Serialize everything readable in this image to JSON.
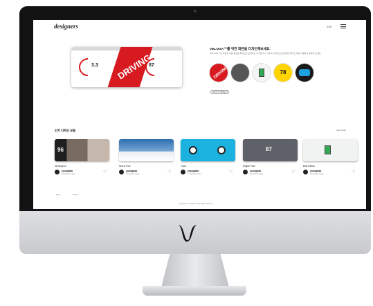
{
  "site": {
    "brand": "designers",
    "lang": "KOR",
    "title": "VELOGA™를 위한 화면을 디자인해보세요.",
    "description": "VELOGA™는 다양한 차량 정보를 화면으로 보여주는 기기입니다. 나만의 디자인으로 화면을 꾸미고 다른 사람들과 공유해 보세요.",
    "button_label": "디자인 더 알아보기"
  },
  "hero": {
    "word": "DRIVING",
    "left_value": "3.3",
    "right_value": "87"
  },
  "circles": [
    {
      "label": "DRIVING"
    },
    {
      "label": ""
    },
    {
      "label": ""
    },
    {
      "label": "78"
    },
    {
      "label": ""
    }
  ],
  "section": {
    "title": "인기 디자인 모음",
    "more": "View More"
  },
  "cards": [
    {
      "title": "Mr.Surgeon",
      "author": "youngdab",
      "stats": "23 Views 0 Likes",
      "big": "96"
    },
    {
      "title": "Sea of Fuel",
      "author": "youngdab",
      "stats": "17 Views 0 Likes"
    },
    {
      "title": "Truck",
      "author": "youngdab",
      "stats": "17 Views 0 Likes"
    },
    {
      "title": "Simple Point",
      "author": "youngdab",
      "stats": "14 Views 0 Likes",
      "big": "87"
    },
    {
      "title": "Blue Retina",
      "author": "youngdab",
      "stats": "10 Views 0 Likes"
    }
  ],
  "footer": {
    "l1": "FAQ",
    "l2": "Notice",
    "copyright": "Copyright © veloga.com All rights reserved."
  }
}
